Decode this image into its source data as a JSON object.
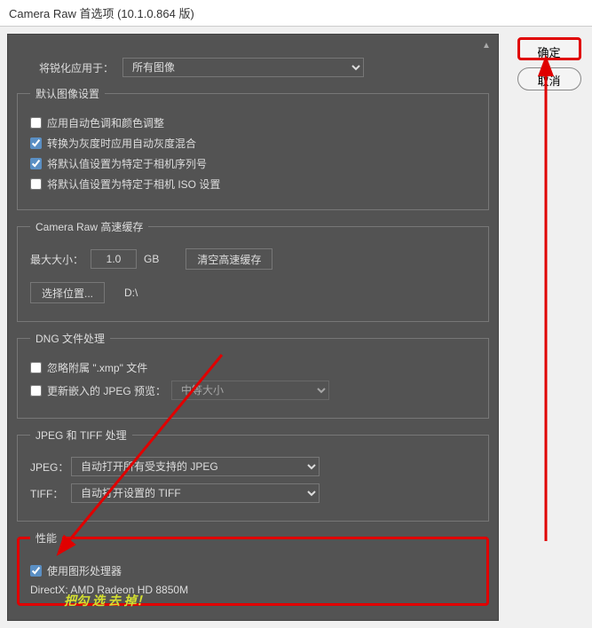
{
  "window": {
    "title": "Camera Raw 首选项  (10.1.0.864 版)"
  },
  "top": {
    "sharpen_label": "将锐化应用于：",
    "sharpen_value": "所有图像"
  },
  "defaults": {
    "legend": "默认图像设置",
    "auto_tone": "应用自动色调和颜色调整",
    "grayscale_mix": "转换为灰度时应用自动灰度混合",
    "camera_serial": "将默认值设置为特定于相机序列号",
    "camera_iso": "将默认值设置为特定于相机 ISO 设置"
  },
  "cache": {
    "legend": "Camera Raw 高速缓存",
    "maxsize_label": "最大大小：",
    "maxsize_value": "1.0",
    "maxsize_unit": "GB",
    "clear_btn": "清空高速缓存",
    "select_loc_btn": "选择位置...",
    "path": "D:\\"
  },
  "dng": {
    "legend": "DNG 文件处理",
    "ignore_xmp": "忽略附属 \".xmp\" 文件",
    "update_jpeg": "更新嵌入的 JPEG 预览：",
    "jpeg_size": "中等大小"
  },
  "jpegtiff": {
    "legend": "JPEG 和 TIFF 处理",
    "jpeg_label": "JPEG：",
    "jpeg_value": "自动打开所有受支持的 JPEG",
    "tiff_label": "TIFF：",
    "tiff_value": "自动打开设置的 TIFF"
  },
  "perf": {
    "legend": "性能",
    "use_gpu": "使用图形处理器",
    "gpu_info": "DirectX: AMD Radeon HD 8850M"
  },
  "buttons": {
    "ok": "确定",
    "cancel": "取消"
  },
  "annotation": "把勾 选 去 掉！"
}
